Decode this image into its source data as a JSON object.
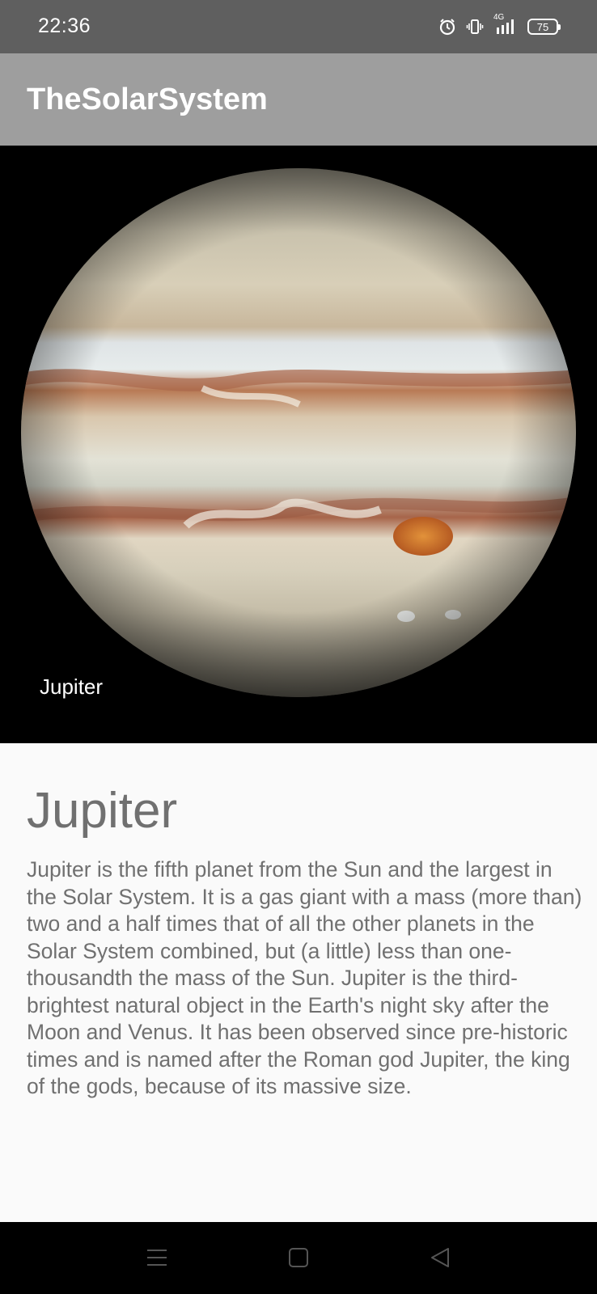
{
  "status_bar": {
    "time": "22:36",
    "network_label": "4G",
    "battery_level": "75",
    "icons": [
      "alarm-icon",
      "vibrate-icon",
      "signal-icon",
      "battery-icon"
    ]
  },
  "app_bar": {
    "title": "TheSolarSystem"
  },
  "hero": {
    "image_subject": "jupiter-planet-image",
    "caption": "Jupiter"
  },
  "content": {
    "name": "Jupiter",
    "description": "Jupiter is the fifth planet from the Sun and the largest in the Solar System. It is a gas giant with a mass (more than) two and a half times that of all the other planets in the Solar System combined, but (a little) less than one-thousandth the mass of the Sun. Jupiter is the third-brightest natural object in the Earth's night sky after the Moon and Venus. It has been observed since pre-historic times and is named after the Roman god Jupiter, the king of the gods, because of its massive size."
  },
  "nav_bar": {
    "icons": [
      "menu-icon",
      "home-icon",
      "back-icon"
    ]
  },
  "colors": {
    "status_bar": "#5f5f5f",
    "app_bar": "#9e9e9e",
    "text_gray": "#707070",
    "background": "#fafafa"
  }
}
